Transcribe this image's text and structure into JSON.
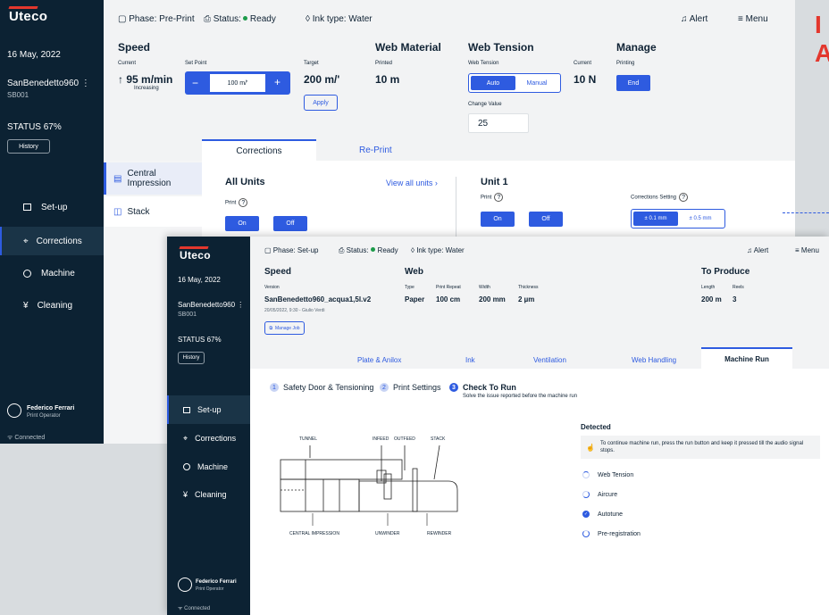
{
  "back": {
    "brand": "Uteco",
    "date": "16 May, 2022",
    "machine_name": "SanBenedetto960",
    "machine_code": "SB001",
    "status": "STATUS 67%",
    "history": "History",
    "nav": [
      "Set-up",
      "Corrections",
      "Machine",
      "Cleaning"
    ],
    "user_name": "Federico Ferrari",
    "user_role": "Print Operator",
    "connected": "Connected",
    "phase": "Phase: Pre-Print",
    "status_label": "Status:",
    "status_value": "Ready",
    "ink": "Ink type: Water",
    "alert": "Alert",
    "menu": "Menu",
    "speed": {
      "title": "Speed",
      "current_label": "Current",
      "current_value": "95 m/min",
      "trend": "Increasing",
      "setpoint_label": "Set Point",
      "setpoint_value": "100 m/'",
      "target_label": "Target",
      "target_value": "200 m/'",
      "apply": "Apply"
    },
    "web_material": {
      "title": "Web  Material",
      "printed_label": "Printed",
      "printed_value": "10 m"
    },
    "web_tension": {
      "title": "Web Tension",
      "label": "Web Tension",
      "auto": "Auto",
      "manual": "Manual",
      "current_label": "Current",
      "current_value": "10 N",
      "change_label": "Change Value",
      "change_value": "25"
    },
    "manage": {
      "title": "Manage",
      "printing": "Printing",
      "end": "End"
    },
    "tabs": [
      "Corrections",
      "Re-Print"
    ],
    "subnav": [
      "Central Impression",
      "Stack"
    ],
    "all_units": {
      "title": "All Units",
      "print": "Print",
      "on": "On",
      "off": "Off",
      "view_all": "View all units"
    },
    "unit1": {
      "title": "Unit 1",
      "print": "Print",
      "on": "On",
      "off": "Off",
      "corr_label": "Corrections Setting",
      "opt1": "± 0.1 mm",
      "opt2": "± 0.5 mm"
    },
    "edge_text": "I\nA"
  },
  "front": {
    "brand": "Uteco",
    "date": "16 May, 2022",
    "machine_name": "SanBenedetto960",
    "machine_code": "SB001",
    "status": "STATUS 67%",
    "history": "History",
    "nav": [
      "Set-up",
      "Corrections",
      "Machine",
      "Cleaning"
    ],
    "user_name": "Federico Ferrari",
    "user_role": "Print Operator",
    "connected": "Connected",
    "phase": "Phase: Set-up",
    "status_label": "Status:",
    "status_value": "Ready",
    "ink": "Ink type: Water",
    "alert": "Alert",
    "menu": "Menu",
    "speed": {
      "title": "Speed",
      "version_label": "Version",
      "version_value": "SanBenedetto960_acqua1,5l.v2",
      "meta": "20/05/2022, 9:30 - Giulio Verdi",
      "manage_job": "Manage Job"
    },
    "web": {
      "title": "Web",
      "type_label": "Type",
      "type_value": "Paper",
      "repeat_label": "Print Repeat",
      "repeat_value": "100 cm",
      "width_label": "Width",
      "width_value": "200 mm",
      "thickness_label": "Thickness",
      "thickness_value": "2 µm"
    },
    "produce": {
      "title": "To Produce",
      "length_label": "Length",
      "length_value": "200 m",
      "reels_label": "Reels",
      "reels_value": "3"
    },
    "tabs": [
      "Plate & Anilox",
      "Ink",
      "Ventilation",
      "Web Handling",
      "Machine Run"
    ],
    "steps": [
      "Safety Door & Tensioning",
      "Print Settings",
      "Check To Run"
    ],
    "step_hint": "Solve the issue reported before the machine run",
    "diagram": {
      "tunnel": "TUNNEL",
      "infeed": "INFEED",
      "outfeed": "OUTFEED",
      "stack": "STACK",
      "central": "CENTRAL IMPRESSION",
      "unwinder": "UNWINDER",
      "rewinder": "REWINDER"
    },
    "detected": {
      "title": "Detected",
      "info": "To continue machine run, press the run button and keep it pressed till the audio signal stops.",
      "items": [
        "Web Tension",
        "Aircure",
        "Autotune",
        "Pre-registration"
      ]
    }
  }
}
